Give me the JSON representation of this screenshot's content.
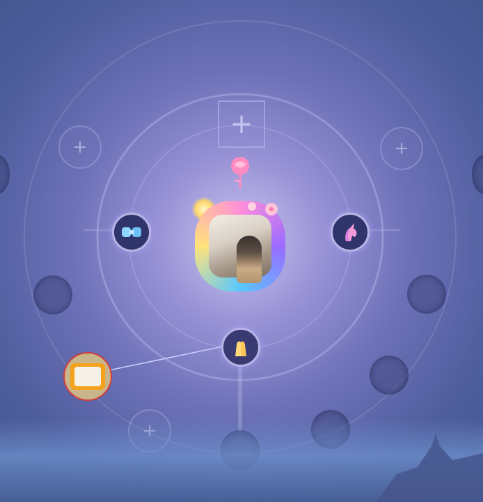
{
  "screen": "orbit-relationship-view",
  "center_avatar": {
    "icon": "profile-photo-with-flower-frame"
  },
  "top_emblem": {
    "icon": "rose-icon",
    "color": "#ff7fb7"
  },
  "square_add_slot": {
    "icon": "plus-icon"
  },
  "badges": [
    {
      "id": "left",
      "icon": "clasped-hands-icon"
    },
    {
      "id": "right",
      "icon": "unicorn-icon"
    },
    {
      "id": "bottom",
      "icon": "praying-hands-icon"
    }
  ],
  "connected_friend": {
    "icon": "food-box-photo"
  },
  "colors": {
    "background_top": "#3f5289",
    "glow": "#c9c4ef",
    "badge_border": "#b8b4e6",
    "link_line": "#c8d0ff"
  }
}
